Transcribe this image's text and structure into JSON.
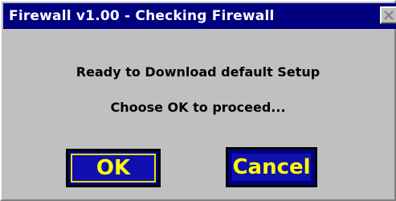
{
  "window": {
    "title": "Firewall v1.00 - Checking Firewall"
  },
  "dialog": {
    "message_line1": "Ready to Download default Setup",
    "message_line2": "Choose OK to proceed..."
  },
  "buttons": {
    "ok_label": "OK",
    "cancel_label": "Cancel"
  },
  "colors": {
    "titlebar": "#000080",
    "dialog_background": "#c0c0c0",
    "button_background": "#1010b0",
    "button_text": "#ffff00"
  },
  "icons": {
    "close": "close-icon"
  }
}
